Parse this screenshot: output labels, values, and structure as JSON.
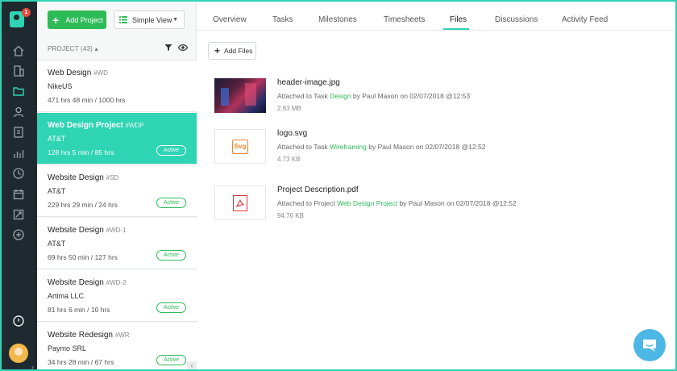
{
  "rail": {
    "logo_badge": "1",
    "icons": [
      "home-icon",
      "building-icon",
      "folder-icon",
      "user-icon",
      "invoice-icon",
      "chart-icon",
      "clock-icon",
      "calendar-icon",
      "report-icon",
      "plus-circle-icon",
      "timer-icon"
    ]
  },
  "toolbar": {
    "add_project_label": "Add Project",
    "view_select_label": "Simple View"
  },
  "list": {
    "header": "PROJECT (43) ▴",
    "projects": [
      {
        "name": "Web Design",
        "code": "#WD",
        "client": "NikeUS",
        "hours": "471 hrs 48 min / 1000 hrs",
        "status": ""
      },
      {
        "name": "Web Design Project",
        "code": "#WDP",
        "client": "AT&T",
        "hours": "128 hrs 5 min / 85 hrs",
        "status": "Active"
      },
      {
        "name": "Website Design",
        "code": "#SD",
        "client": "AT&T",
        "hours": "229 hrs 29 min / 24 hrs",
        "status": "Active"
      },
      {
        "name": "Website Design",
        "code": "#WD-1",
        "client": "AT&T",
        "hours": "69 hrs 50 min / 127 hrs",
        "status": "Active"
      },
      {
        "name": "Website Design",
        "code": "#WD-2",
        "client": "Artima LLC",
        "hours": "81 hrs 6 min / 10 hrs",
        "status": "Active"
      },
      {
        "name": "Website Redesign",
        "code": "#WR",
        "client": "Paymo SRL",
        "hours": "34 hrs 28 min / 67 hrs",
        "status": "Active"
      }
    ],
    "first_status": "Active"
  },
  "tabs": [
    "Overview",
    "Tasks",
    "Milestones",
    "Timesheets",
    "Files",
    "Discussions",
    "Activity Feed"
  ],
  "active_tab": "Files",
  "files_toolbar": {
    "add_files_label": "Add Files"
  },
  "files": [
    {
      "name": "header-image.jpg",
      "prefix": "Attached to Task ",
      "link": "Design",
      "suffix": " by Paul Mason on 02/07/2018 @12:53",
      "size": "2.93 MB",
      "thumb": "photo"
    },
    {
      "name": "logo.svg",
      "prefix": "Attached to Task ",
      "link": "Wireframing",
      "suffix": " by Paul Mason on 02/07/2018 @12:52",
      "size": "4.73 KB",
      "thumb": "svg",
      "thumb_label": "Svg"
    },
    {
      "name": "Project Description.pdf",
      "prefix": "Attached to Project ",
      "link": "Web Design Project",
      "suffix": " by Paul Mason on 02/07/2018 @12:52",
      "size": "94.76 KB",
      "thumb": "pdf"
    }
  ],
  "colors": {
    "accent": "#2fd4b4",
    "primary_green": "#2dbb58",
    "rail_bg": "#1f2a30",
    "chat_blue": "#4db7e6"
  }
}
